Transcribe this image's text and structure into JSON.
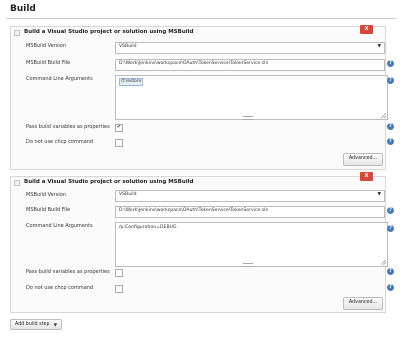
{
  "section": {
    "title": "Build"
  },
  "steps": [
    {
      "title": "Build a Visual Studio project or solution using MSBuild",
      "delete_label": "X",
      "version_label": "MSBuild Version",
      "version_value": "VSBuild",
      "file_label": "MSBuild Build File",
      "file_value": "D:\\Work\\Jenkins\\workspace\\OAuth\\TokenService\\TokenService.sln",
      "args_label": "Command Line Arguments",
      "args_value": "/t:restore",
      "pass_vars_label": "Pass build variables as properties",
      "pass_vars_checked": true,
      "pass_vars_mark": "✔",
      "chcp_label": "Do not use chcp command",
      "chcp_checked": false,
      "advanced_label": "Advanced..."
    },
    {
      "title": "Build a Visual Studio project or solution using MSBuild",
      "delete_label": "X",
      "version_label": "MSBuild Version",
      "version_value": "VSBuild",
      "file_label": "MSBuild Build File",
      "file_value": "D:\\Work\\Jenkins\\workspace\\OAuth\\TokenService\\TokenService.sln",
      "args_label": "Command Line Arguments",
      "args_value": "/p:Configuration=DEBUG",
      "pass_vars_label": "Pass build variables as properties",
      "pass_vars_checked": false,
      "pass_vars_mark": "",
      "chcp_label": "Do not use chcp command",
      "chcp_checked": false,
      "advanced_label": "Advanced..."
    }
  ],
  "add_step": {
    "label": "Add build step",
    "caret": "▼"
  },
  "icons": {
    "help": "?",
    "select_caret": "▼"
  },
  "colors": {
    "delete": "#d24939",
    "help": "#4b79b5"
  }
}
